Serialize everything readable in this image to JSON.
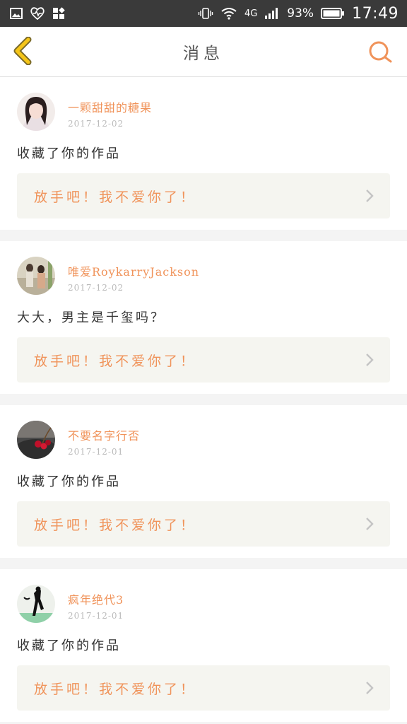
{
  "statusbar": {
    "network": "4G",
    "battery": "93%",
    "time": "17:49"
  },
  "navbar": {
    "title": "消息"
  },
  "messages": [
    {
      "name": "一颗甜甜的糖果",
      "date": "2017-12-02",
      "text": "收藏了你的作品",
      "quote": "放手吧！我不爱你了！"
    },
    {
      "name": "唯爱RoykarryJackson",
      "date": "2017-12-02",
      "text": "大大，男主是千玺吗？",
      "quote": "放手吧！我不爱你了！"
    },
    {
      "name": "不要名字行否",
      "date": "2017-12-01",
      "text": "收藏了你的作品",
      "quote": "放手吧！我不爱你了！"
    },
    {
      "name": "疯年绝代3",
      "date": "2017-12-01",
      "text": "收藏了你的作品",
      "quote": "放手吧！我不爱你了！"
    }
  ],
  "colors": {
    "accent": "#f0935a",
    "back_arrow": "#f5c518",
    "statusbar_bg": "#3a3a3a"
  }
}
